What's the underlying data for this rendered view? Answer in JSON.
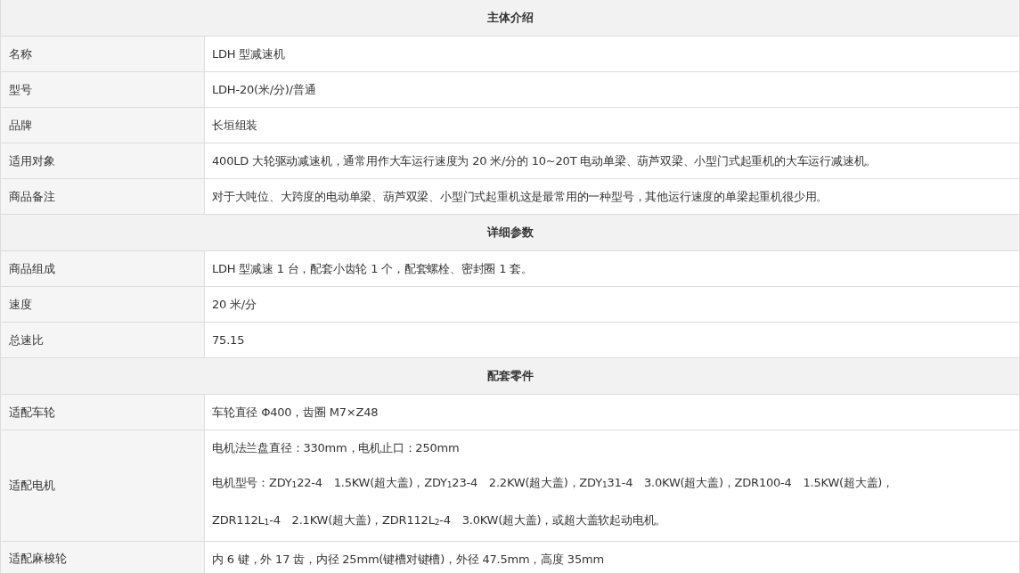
{
  "sections": [
    {
      "title": "主体介绍",
      "rows": [
        {
          "label": "名称",
          "lines": [
            "LDH 型减速机"
          ]
        },
        {
          "label": "型号",
          "lines": [
            "LDH-20(米/分)/普通"
          ]
        },
        {
          "label": "品牌",
          "lines": [
            "长垣组装"
          ]
        },
        {
          "label": "适用对象",
          "lines": [
            "400LD 大轮驱动减速机，通常用作大车运行速度为 20 米/分的 10~20T 电动单梁、葫芦双梁、小型门式起重机的大车运行减速机。"
          ]
        },
        {
          "label": "商品备注",
          "lines": [
            "对于大吨位、大跨度的电动单梁、葫芦双梁、小型门式起重机这是最常用的一种型号，其他运行速度的单梁起重机很少用。"
          ]
        }
      ]
    },
    {
      "title": "详细参数",
      "rows": [
        {
          "label": "商品组成",
          "lines": [
            "LDH 型减速 1 台，配套小齿轮 1 个，配套螺栓、密封圈 1 套。"
          ]
        },
        {
          "label": "速度",
          "lines": [
            "20  米/分"
          ]
        },
        {
          "label": "总速比",
          "lines": [
            "75.15"
          ]
        }
      ]
    },
    {
      "title": "配套零件",
      "rows": [
        {
          "label": "适配车轮",
          "lines": [
            "车轮直径 Φ400，齿圈 M7×Z48"
          ]
        },
        {
          "label": "适配电机",
          "lines": [
            "电机法兰盘直径：330mm，电机止口：250mm",
            "电机型号：ZDY$_{1}$22-4　1.5KW(超大盖)，ZDY$_{1}$23-4　2.2KW(超大盖)，ZDY$_{1}$31-4　3.0KW(超大盖)，ZDR100-4　1.5KW(超大盖)，",
            "ZDR112L$_{1}$-4　2.1KW(超大盖)，ZDR112L$_{2}$-4　3.0KW(超大盖)，或超大盖软起动电机。"
          ]
        },
        {
          "label": "适配麻梭轮",
          "lines": [
            "内 6 键，外 17 齿，内径 25mm(键槽对键槽)，外径 47.5mm，高度 35mm"
          ]
        }
      ]
    }
  ]
}
